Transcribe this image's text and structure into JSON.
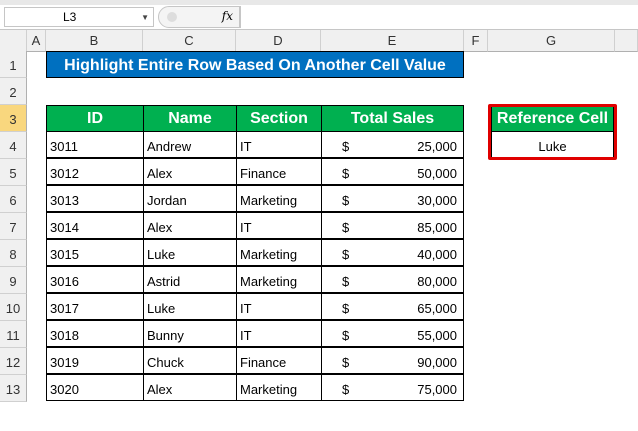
{
  "formula_bar": {
    "name_box": "L3",
    "fx_label": "fx",
    "formula": ""
  },
  "columns": [
    "A",
    "B",
    "C",
    "D",
    "E",
    "F",
    "G"
  ],
  "rows": [
    "1",
    "2",
    "3",
    "4",
    "5",
    "6",
    "7",
    "8",
    "9",
    "10",
    "11",
    "12",
    "13"
  ],
  "title": "Highlight Entire Row Based On Another Cell Value",
  "table": {
    "headers": [
      "ID",
      "Name",
      "Section",
      "Total Sales"
    ],
    "currency": "$",
    "rows": [
      [
        "3011",
        "Andrew",
        "IT",
        "25,000"
      ],
      [
        "3012",
        "Alex",
        "Finance",
        "50,000"
      ],
      [
        "3013",
        "Jordan",
        "Marketing",
        "30,000"
      ],
      [
        "3014",
        "Alex",
        "IT",
        "85,000"
      ],
      [
        "3015",
        "Luke",
        "Marketing",
        "40,000"
      ],
      [
        "3016",
        "Astrid",
        "Marketing",
        "80,000"
      ],
      [
        "3017",
        "Luke",
        "IT",
        "65,000"
      ],
      [
        "3018",
        "Bunny",
        "IT",
        "55,000"
      ],
      [
        "3019",
        "Chuck",
        "Finance",
        "90,000"
      ],
      [
        "3020",
        "Alex",
        "Marketing",
        "75,000"
      ]
    ]
  },
  "reference": {
    "header": "Reference Cell",
    "value": "Luke"
  },
  "colors": {
    "title_bg": "#0070c0",
    "header_bg": "#00b050",
    "ref_border": "#e00000"
  }
}
